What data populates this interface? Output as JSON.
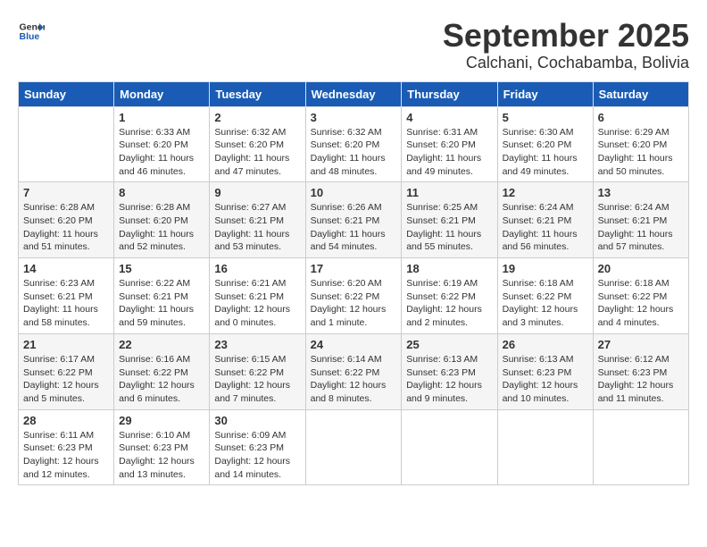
{
  "header": {
    "logo_line1": "General",
    "logo_line2": "Blue",
    "month": "September 2025",
    "location": "Calchani, Cochabamba, Bolivia"
  },
  "weekdays": [
    "Sunday",
    "Monday",
    "Tuesday",
    "Wednesday",
    "Thursday",
    "Friday",
    "Saturday"
  ],
  "weeks": [
    [
      {
        "day": "",
        "info": ""
      },
      {
        "day": "1",
        "info": "Sunrise: 6:33 AM\nSunset: 6:20 PM\nDaylight: 11 hours\nand 46 minutes."
      },
      {
        "day": "2",
        "info": "Sunrise: 6:32 AM\nSunset: 6:20 PM\nDaylight: 11 hours\nand 47 minutes."
      },
      {
        "day": "3",
        "info": "Sunrise: 6:32 AM\nSunset: 6:20 PM\nDaylight: 11 hours\nand 48 minutes."
      },
      {
        "day": "4",
        "info": "Sunrise: 6:31 AM\nSunset: 6:20 PM\nDaylight: 11 hours\nand 49 minutes."
      },
      {
        "day": "5",
        "info": "Sunrise: 6:30 AM\nSunset: 6:20 PM\nDaylight: 11 hours\nand 49 minutes."
      },
      {
        "day": "6",
        "info": "Sunrise: 6:29 AM\nSunset: 6:20 PM\nDaylight: 11 hours\nand 50 minutes."
      }
    ],
    [
      {
        "day": "7",
        "info": "Sunrise: 6:28 AM\nSunset: 6:20 PM\nDaylight: 11 hours\nand 51 minutes."
      },
      {
        "day": "8",
        "info": "Sunrise: 6:28 AM\nSunset: 6:20 PM\nDaylight: 11 hours\nand 52 minutes."
      },
      {
        "day": "9",
        "info": "Sunrise: 6:27 AM\nSunset: 6:21 PM\nDaylight: 11 hours\nand 53 minutes."
      },
      {
        "day": "10",
        "info": "Sunrise: 6:26 AM\nSunset: 6:21 PM\nDaylight: 11 hours\nand 54 minutes."
      },
      {
        "day": "11",
        "info": "Sunrise: 6:25 AM\nSunset: 6:21 PM\nDaylight: 11 hours\nand 55 minutes."
      },
      {
        "day": "12",
        "info": "Sunrise: 6:24 AM\nSunset: 6:21 PM\nDaylight: 11 hours\nand 56 minutes."
      },
      {
        "day": "13",
        "info": "Sunrise: 6:24 AM\nSunset: 6:21 PM\nDaylight: 11 hours\nand 57 minutes."
      }
    ],
    [
      {
        "day": "14",
        "info": "Sunrise: 6:23 AM\nSunset: 6:21 PM\nDaylight: 11 hours\nand 58 minutes."
      },
      {
        "day": "15",
        "info": "Sunrise: 6:22 AM\nSunset: 6:21 PM\nDaylight: 11 hours\nand 59 minutes."
      },
      {
        "day": "16",
        "info": "Sunrise: 6:21 AM\nSunset: 6:21 PM\nDaylight: 12 hours\nand 0 minutes."
      },
      {
        "day": "17",
        "info": "Sunrise: 6:20 AM\nSunset: 6:22 PM\nDaylight: 12 hours\nand 1 minute."
      },
      {
        "day": "18",
        "info": "Sunrise: 6:19 AM\nSunset: 6:22 PM\nDaylight: 12 hours\nand 2 minutes."
      },
      {
        "day": "19",
        "info": "Sunrise: 6:18 AM\nSunset: 6:22 PM\nDaylight: 12 hours\nand 3 minutes."
      },
      {
        "day": "20",
        "info": "Sunrise: 6:18 AM\nSunset: 6:22 PM\nDaylight: 12 hours\nand 4 minutes."
      }
    ],
    [
      {
        "day": "21",
        "info": "Sunrise: 6:17 AM\nSunset: 6:22 PM\nDaylight: 12 hours\nand 5 minutes."
      },
      {
        "day": "22",
        "info": "Sunrise: 6:16 AM\nSunset: 6:22 PM\nDaylight: 12 hours\nand 6 minutes."
      },
      {
        "day": "23",
        "info": "Sunrise: 6:15 AM\nSunset: 6:22 PM\nDaylight: 12 hours\nand 7 minutes."
      },
      {
        "day": "24",
        "info": "Sunrise: 6:14 AM\nSunset: 6:22 PM\nDaylight: 12 hours\nand 8 minutes."
      },
      {
        "day": "25",
        "info": "Sunrise: 6:13 AM\nSunset: 6:23 PM\nDaylight: 12 hours\nand 9 minutes."
      },
      {
        "day": "26",
        "info": "Sunrise: 6:13 AM\nSunset: 6:23 PM\nDaylight: 12 hours\nand 10 minutes."
      },
      {
        "day": "27",
        "info": "Sunrise: 6:12 AM\nSunset: 6:23 PM\nDaylight: 12 hours\nand 11 minutes."
      }
    ],
    [
      {
        "day": "28",
        "info": "Sunrise: 6:11 AM\nSunset: 6:23 PM\nDaylight: 12 hours\nand 12 minutes."
      },
      {
        "day": "29",
        "info": "Sunrise: 6:10 AM\nSunset: 6:23 PM\nDaylight: 12 hours\nand 13 minutes."
      },
      {
        "day": "30",
        "info": "Sunrise: 6:09 AM\nSunset: 6:23 PM\nDaylight: 12 hours\nand 14 minutes."
      },
      {
        "day": "",
        "info": ""
      },
      {
        "day": "",
        "info": ""
      },
      {
        "day": "",
        "info": ""
      },
      {
        "day": "",
        "info": ""
      }
    ]
  ]
}
